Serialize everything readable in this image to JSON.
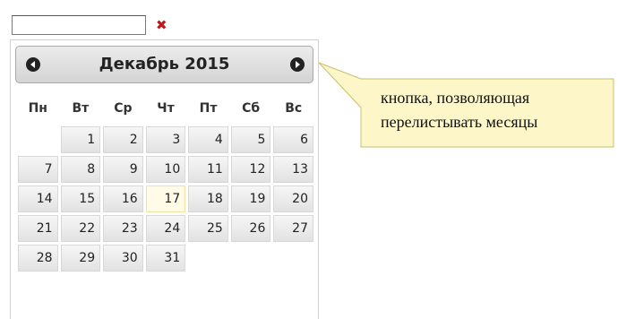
{
  "date_field": {
    "value": "",
    "clear_icon": "close-icon",
    "clear_glyph": "✖",
    "clear_color": "#c0181b"
  },
  "datepicker": {
    "title": "Декабрь 2015",
    "prev_icon": "circle-triangle-left-icon",
    "next_icon": "circle-triangle-right-icon",
    "weekdays": [
      "Пн",
      "Вт",
      "Ср",
      "Чт",
      "Пт",
      "Сб",
      "Вс"
    ],
    "weeks": [
      [
        "",
        "1",
        "2",
        "3",
        "4",
        "5",
        "6"
      ],
      [
        "7",
        "8",
        "9",
        "10",
        "11",
        "12",
        "13"
      ],
      [
        "14",
        "15",
        "16",
        "17",
        "18",
        "19",
        "20"
      ],
      [
        "21",
        "22",
        "23",
        "24",
        "25",
        "26",
        "27"
      ],
      [
        "28",
        "29",
        "30",
        "31",
        "",
        "",
        ""
      ]
    ],
    "highlighted_day": "17",
    "highlight_color": "#fffbe6"
  },
  "callout": {
    "line1": "кнопка, позволяющая",
    "line2": "перелистывать месяцы",
    "fill_color": "#fdf6c8",
    "border_color": "#c9bf6a"
  }
}
